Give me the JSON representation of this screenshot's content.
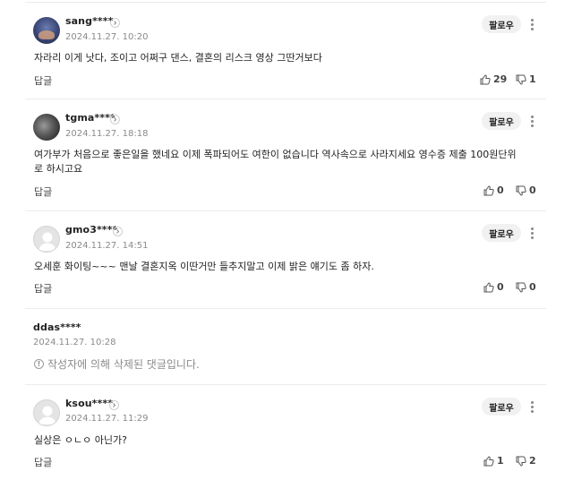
{
  "common": {
    "follow_label": "팔로우",
    "reply_label": "답글"
  },
  "comments": [
    {
      "nickname": "sang****",
      "date": "2024.11.27. 10:20",
      "text": "자라리 이게 낫다, 조이고 어쩌구 댄스, 결혼의 리스크 영상 그딴거보다",
      "likes": "29",
      "dislikes": "1",
      "avatar": "photo"
    },
    {
      "nickname": "tgma****",
      "date": "2024.11.27. 18:18",
      "text": "여가부가 처음으로 좋은일을 했네요 이제 폭파되어도 여한이 없습니다 역사속으로 사라지세요 영수증 제출 100원단위로 하시고요",
      "likes": "0",
      "dislikes": "0",
      "avatar": "photo"
    },
    {
      "nickname": "gmo3****",
      "date": "2024.11.27. 14:51",
      "text": "오세훈 화이팅~~~ 맨날 결혼지옥 이딴거만 들추지말고 이제 밝은 얘기도 좀 하자.",
      "likes": "0",
      "dislikes": "0",
      "avatar": "default"
    },
    {
      "nickname": "ddas****",
      "date": "2024.11.27. 10:28",
      "deleted_text": "작성자에 의해 삭제된 댓글입니다.",
      "info_icon_glyph": "!"
    },
    {
      "nickname": "ksou****",
      "date": "2024.11.27. 11:29",
      "text": "실상은 ㅇㄴㅇ 아닌가?",
      "likes": "1",
      "dislikes": "2",
      "avatar": "default"
    }
  ],
  "icons": [
    "chevron-right-icon",
    "more-vertical-icon",
    "thumbs-up-icon",
    "thumbs-down-icon",
    "info-icon",
    "default-avatar-icon"
  ]
}
